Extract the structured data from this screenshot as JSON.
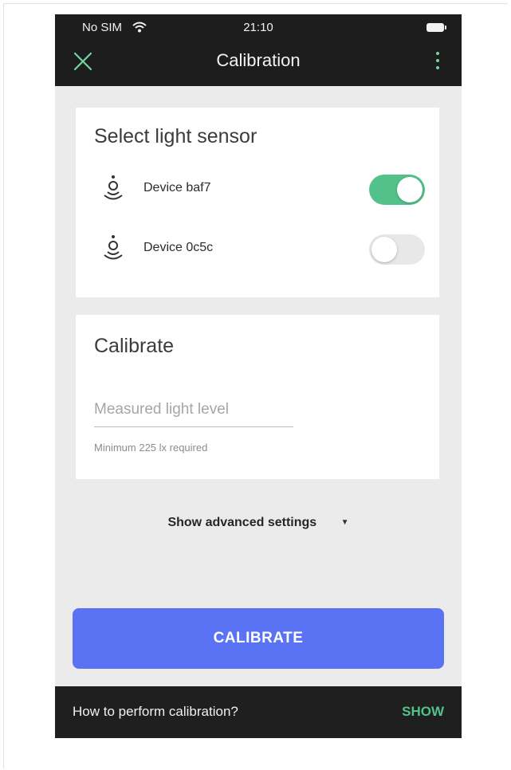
{
  "status": {
    "carrier": "No SIM",
    "time": "21:10"
  },
  "header": {
    "title": "Calibration"
  },
  "sensors": {
    "title": "Select light sensor",
    "devices": [
      {
        "name": "Device baf7",
        "enabled": true
      },
      {
        "name": "Device 0c5c",
        "enabled": false
      }
    ]
  },
  "calibrate": {
    "title": "Calibrate",
    "input_placeholder": "Measured light level",
    "input_value": "",
    "helper": "Minimum 225 lx required"
  },
  "advanced": {
    "label": "Show advanced settings"
  },
  "actions": {
    "calibrate_label": "CALIBRATE"
  },
  "snackbar": {
    "text": "How to perform calibration?",
    "action": "SHOW"
  },
  "colors": {
    "accent_green": "#52c28a",
    "primary_button": "#5a73f5",
    "topbar": "#1d1d1d"
  },
  "icons": [
    "wifi-icon",
    "battery-icon",
    "close-icon",
    "more-vert-icon",
    "light-sensor-icon",
    "chevron-down-icon"
  ]
}
